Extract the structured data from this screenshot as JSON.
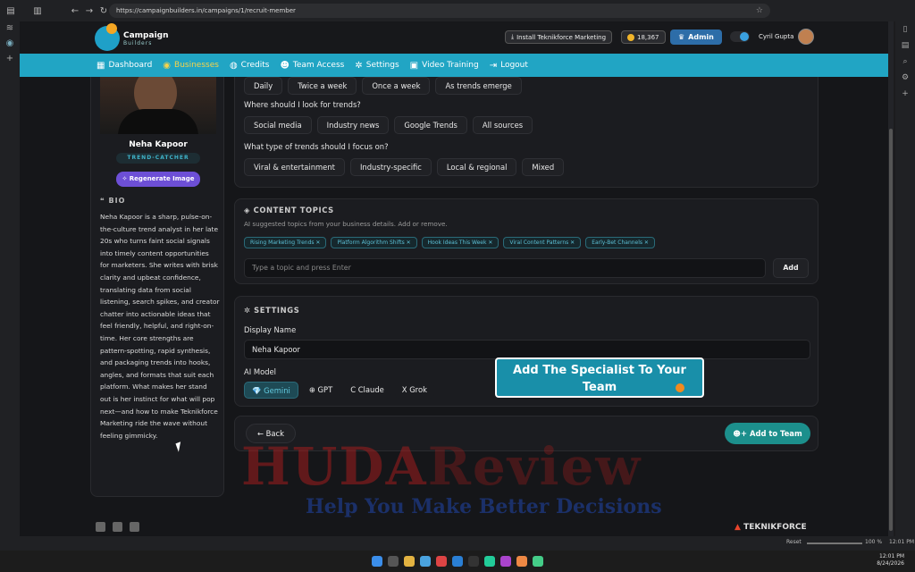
{
  "browser": {
    "url": "https://campaignbuilders.in/campaigns/1/recruit-member"
  },
  "header": {
    "logo_line1": "Campaign",
    "logo_line2": "Builders",
    "install_label": "Install Teknikforce Marketing",
    "credits": "18,367",
    "admin_label": "Admin",
    "user_name": "Cyril Gupta"
  },
  "nav": [
    {
      "label": "Dashboard",
      "icon": "▦"
    },
    {
      "label": "Businesses",
      "icon": "◉"
    },
    {
      "label": "Credits",
      "icon": "◍"
    },
    {
      "label": "Team Access",
      "icon": "☻"
    },
    {
      "label": "Settings",
      "icon": "✲"
    },
    {
      "label": "Video Training",
      "icon": "▣"
    },
    {
      "label": "Logout",
      "icon": "⇥"
    }
  ],
  "profile": {
    "name": "Neha Kapoor",
    "role": "TREND-CATCHER",
    "regen_label": "Regenerate Image",
    "bio_heading": "BIO",
    "bio": "Neha Kapoor is a sharp, pulse-on-the-culture trend analyst in her late 20s who turns faint social signals into timely content opportunities for marketers. She writes with brisk clarity and upbeat confidence, translating data from social listening, search spikes, and creator chatter into actionable ideas that feel friendly, helpful, and right-on-time. Her core strengths are pattern-spotting, rapid synthesis, and packaging trends into hooks, angles, and formats that suit each platform. What makes her stand out is her instinct for what will pop next—and how to make Teknikforce Marketing ride the wave without feeling gimmicky."
  },
  "questions": {
    "frequency_options": [
      "Daily",
      "Twice a week",
      "Once a week",
      "As trends emerge"
    ],
    "where_label": "Where should I look for trends?",
    "where_options": [
      "Social media",
      "Industry news",
      "Google Trends",
      "All sources"
    ],
    "type_label": "What type of trends should I focus on?",
    "type_options": [
      "Viral & entertainment",
      "Industry-specific",
      "Local & regional",
      "Mixed"
    ]
  },
  "topics": {
    "heading": "CONTENT TOPICS",
    "subtitle": "AI suggested topics from your business details. Add or remove.",
    "tags": [
      "Rising Marketing Trends ✕",
      "Platform Algorithm Shifts ✕",
      "Hook Ideas This Week ✕",
      "Viral Content Patterns ✕",
      "Early-Bet Channels ✕"
    ],
    "input_placeholder": "Type a topic and press Enter",
    "add_label": "Add"
  },
  "settings": {
    "heading": "SETTINGS",
    "display_name_label": "Display Name",
    "display_name_value": "Neha Kapoor",
    "ai_model_label": "AI Model",
    "models": [
      "💎 Gemini",
      "⊕ GPT",
      "C Claude",
      "X Grok"
    ],
    "selected_model": "Gemini"
  },
  "actions": {
    "back_label": "← Back",
    "add_team_label": "Add to Team"
  },
  "callout": {
    "text": "Add The Specialist To Your Team"
  },
  "watermark": {
    "line1": "HUDA",
    "line1b": "Review",
    "line2": "Help You Make Better Decisions"
  },
  "footer": {
    "brand": "TEKNIKFORCE"
  },
  "statusbar": {
    "zoom_label": "Reset",
    "zoom_pct": "100 %",
    "time": "12:01 PM"
  },
  "tray": {
    "time": "12:01 PM",
    "date": "8/24/2026"
  },
  "colors": {
    "accent": "#21a5c4",
    "active_nav": "#f6d34a",
    "primary_btn": "#1c8f8c",
    "regen_btn": "#6d4fd6"
  }
}
